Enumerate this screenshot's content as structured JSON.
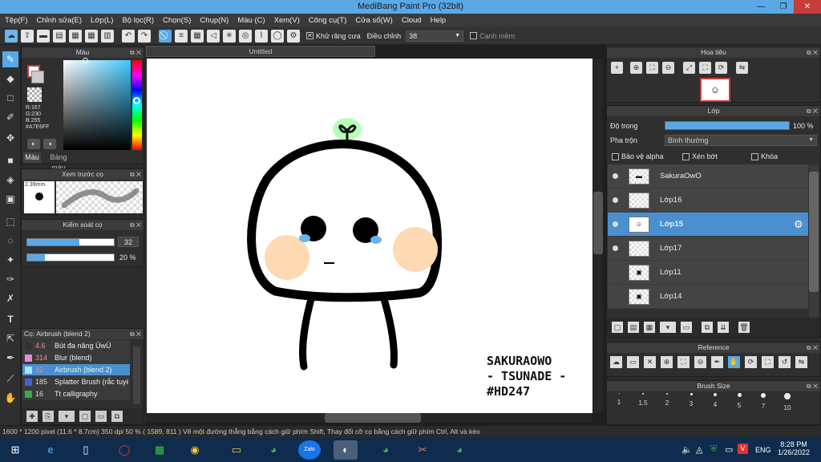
{
  "title": "MediBang Paint Pro (32bit)",
  "menu": [
    "Tệp(F)",
    "Chỉnh sửa(E)",
    "Lớp(L)",
    "Bộ lọc(R)",
    "Chọn(S)",
    "Chụp(N)",
    "Màu (C)",
    "Xem(V)",
    "Công cụ(T)",
    "Cửa sổ(W)",
    "Cloud",
    "Help"
  ],
  "toolbar": {
    "antialias_label": "Khử răng cưa",
    "adjust_label": "Điều chỉnh",
    "adjust_value": "38",
    "snap_label": "Cạnh mềm"
  },
  "color_panel": {
    "title": "Màu",
    "rgb": "R:167\nG:230\nB:255",
    "hex": "#A7E6FF",
    "tab1": "Màu",
    "tab2": "Bảng màu",
    "accent": "#A7E6FF"
  },
  "brush_preview": {
    "title": "Xem trước cọ",
    "size": "2.39mm"
  },
  "brush_control": {
    "title": "Kiểm soát cọ",
    "size": "32",
    "opacity": "20 %",
    "size_fraction": 0.6,
    "opacity_fraction": 0.2
  },
  "brush_list": {
    "title": "Cọ: Airbrush (blend 2)",
    "items": [
      {
        "size": "4.6",
        "name": "Bút đa năng ÙwÙ",
        "color": "#333333"
      },
      {
        "size": "314",
        "name": "Blur (blend)",
        "color": "#e28bd8"
      },
      {
        "size": "32",
        "name": "Airbrush (blend 2)",
        "color": "#a7e6ff"
      },
      {
        "size": "185",
        "name": "Splatter Brush (rắc tuyết)",
        "color": "#3f63d8"
      },
      {
        "size": "16",
        "name": "Tt calligraphy",
        "color": "#31b04a"
      }
    ]
  },
  "canvas": {
    "tab": "Untitled",
    "signature": "SAKURAOWO\n- TSUNADE -\n#HD247"
  },
  "navigator": {
    "title": "Hoa tiêu"
  },
  "layers": {
    "title": "Lớp",
    "opacity_label": "Độ trong",
    "opacity_value": "100 %",
    "opacity_fraction": 1.0,
    "blend_label": "Pha trộn",
    "blend_value": "Bình thường",
    "protect_alpha": "Bảo vệ alpha",
    "clipping": "Xén bớt",
    "lock": "Khóa",
    "items": [
      {
        "name": "SakuraOwO",
        "selected": false,
        "visible": true
      },
      {
        "name": "Lớp16",
        "selected": false,
        "visible": true
      },
      {
        "name": "Lớp15",
        "selected": true,
        "visible": true
      },
      {
        "name": "Lớp17",
        "selected": false,
        "visible": true
      },
      {
        "name": "Lớp11",
        "selected": false,
        "visible": false
      },
      {
        "name": "Lớp14",
        "selected": false,
        "visible": false
      }
    ]
  },
  "reference": {
    "title": "Reference"
  },
  "brush_size": {
    "title": "Brush Size",
    "sizes": [
      "1",
      "1.5",
      "2",
      "3",
      "4",
      "5",
      "7",
      "10"
    ]
  },
  "status": "1600 * 1200 pixel   (11.6 * 8.7cm)   350 dpi   50 %   ( 1589, 811 )   Vẽ một đường thẳng bằng cách giữ phím Shift, Thay đổi cỡ cọ bằng cách giữ phím Ctrl, Alt và kéo",
  "taskbar": {
    "time": "8:28 PM",
    "date": "1/26/2022",
    "lang": "ENG",
    "zalo": "Zalo"
  }
}
